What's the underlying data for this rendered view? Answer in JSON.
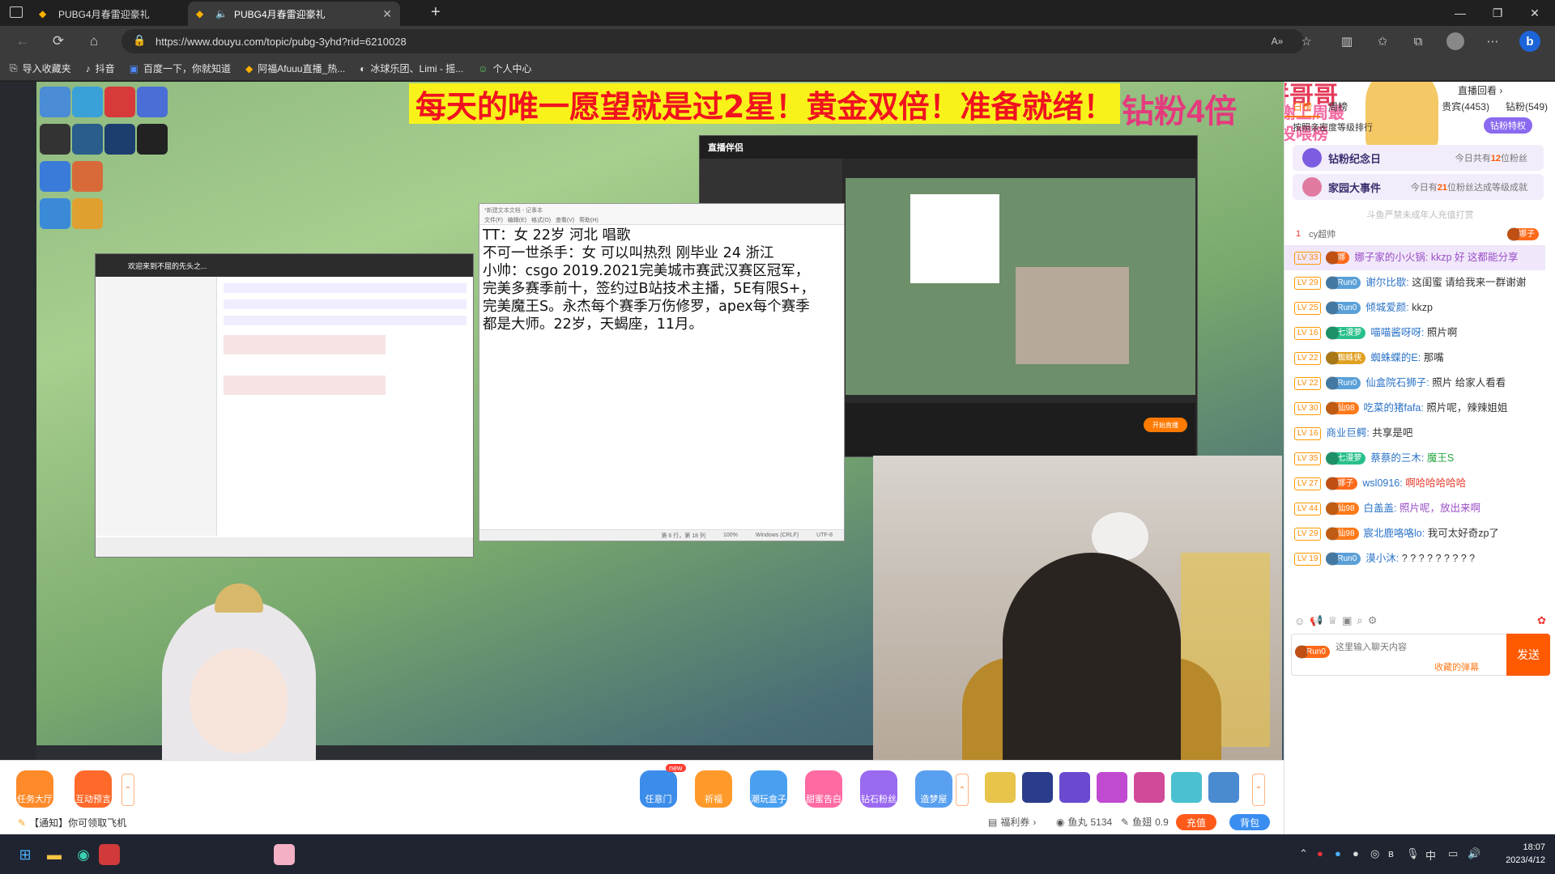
{
  "browser": {
    "tabs": [
      {
        "title": "PUBG4月春雷迎豪礼",
        "active": false
      },
      {
        "title": "PUBG4月春雷迎豪礼",
        "active": true
      }
    ],
    "url": "https://www.douyu.com/topic/pubg-3yhd?rid=6210028",
    "bookmarks": [
      "导入收藏夹",
      "抖音",
      "百度一下，你就知道",
      "阿福Afuuu直播_热...",
      "冰球乐团、Limi - 摇...",
      "个人中心"
    ]
  },
  "stream": {
    "banner": "每天的唯一愿望就是过2星！黄金双倍！准备就绪！",
    "banner_side": "钻粉4倍",
    "overlay_name": "饼哥哥",
    "overlay_thanks": "感谢上周最佳投喂榜",
    "notepad": {
      "title": "*新建文本文档 - 记事本",
      "menu": [
        "文件(F)",
        "编辑(E)",
        "格式(O)",
        "查看(V)",
        "帮助(H)"
      ],
      "text": "TT：女 22岁 河北 唱歌\n不可一世杀手：女 可以叫热烈 刚毕业 24 浙江\n小帅：csgo 2019.2021完美城市赛武汉赛区冠军，\n完美多赛季前十，签约过B站技术主播，5E有限S+，\n完美魔王S。永杰每个赛季万伤修罗，apex每个赛季\n都是大师。22岁，天蝎座，11月。",
      "status": [
        "第 6 行，第 18 列",
        "100%",
        "Windows (CRLF)",
        "UTF-8"
      ]
    },
    "companion_title": "直播伴侣",
    "companion_live": "开始直播",
    "qq_title": "欢迎来到不屈的先头之..."
  },
  "giftbar": {
    "left_buttons": [
      "任务大厅",
      "互动预言"
    ],
    "center_buttons": [
      "任意门",
      "祈福",
      "潮玩盒子",
      "甜蜜告白",
      "钻石粉丝",
      "造梦屋"
    ],
    "new_tag": "new",
    "notice": "【通知】你可领取飞机",
    "wallet": {
      "coupon": "福利券",
      "fish_ball_label": "鱼丸",
      "fish_ball": "5134",
      "fish_wing_label": "鱼翅",
      "fish_wing": "0.9"
    },
    "recharge": "充值",
    "backpack": "背包"
  },
  "rightpanel": {
    "replay": "直播回看",
    "tabs": [
      "日榜",
      "周榜",
      "贵宾(4453)",
      "钻粉(549)"
    ],
    "privilege": "钻粉特权",
    "rank_note": "按照亲密度等级排行",
    "cards": [
      {
        "title": "钻粉纪念日",
        "sub_prefix": "今日共有",
        "sub_num": "12",
        "sub_suffix": "位粉丝"
      },
      {
        "title": "家园大事件",
        "sub_prefix": "今日有",
        "sub_num": "21",
        "sub_suffix": "位粉丝达成等级成就"
      }
    ],
    "minor_note": "斗鱼严禁未成年人充值打赏",
    "top_rank": {
      "num": "1",
      "name": "cy超帅",
      "badge": "娜子"
    },
    "messages": [
      {
        "lv": "LV 33",
        "badge": "娜",
        "user": "娜子家的小火锅:",
        "text": "kkzp 好 这都能分享",
        "hl": true,
        "color": "purple"
      },
      {
        "lv": "LV 29",
        "badge": "Run0",
        "user": "谢尔比歇:",
        "text": "这闺蜜 请给我来一群谢谢"
      },
      {
        "lv": "LV 25",
        "badge": "Run0",
        "user": "倾城爱颜:",
        "text": "kkzp"
      },
      {
        "lv": "LV 16",
        "badge": "七漫萝",
        "user": "喵喵酱呀呀:",
        "text": "照片啊"
      },
      {
        "lv": "LV 22",
        "badge": "蜘蛛侠",
        "user": "蜘蛛蝶的E:",
        "text": "那嘴"
      },
      {
        "lv": "LV 22",
        "badge": "Run0",
        "user": "仙盒院石狮子:",
        "text": "照片 给家人看看"
      },
      {
        "lv": "LV 30",
        "badge": "仙98",
        "user": "吃菜的猪fafa:",
        "text": "照片呢，辣辣姐姐"
      },
      {
        "lv": "LV 16",
        "badge": "",
        "user": "商业巨鳄:",
        "text": "共享是吧"
      },
      {
        "lv": "LV 35",
        "badge": "七漫萝",
        "user": "蔡蔡的三木:",
        "text": "魔王S",
        "color": "green"
      },
      {
        "lv": "LV 27",
        "badge": "娜子",
        "user": "wsl0916:",
        "text": "啊哈哈哈哈哈",
        "color": "red"
      },
      {
        "lv": "LV 44",
        "badge": "仙98",
        "user": "白盖盖:",
        "text": "照片呢，放出来啊",
        "color": "purple"
      },
      {
        "lv": "LV 29",
        "badge": "仙98",
        "user": "宸北鹿咯咯lo:",
        "text": "我可太好奇zp了"
      },
      {
        "lv": "LV 19",
        "badge": "Run0",
        "user": "漠小沐:",
        "text": "? ? ? ? ? ? ? ? ?"
      }
    ],
    "input_placeholder": "这里输入聊天内容",
    "input_badge": "Run0",
    "barrage_label": "收藏的弹幕",
    "send": "发送"
  },
  "taskbar": {
    "time": "18:07",
    "date": "2023/4/12",
    "ime": "中"
  }
}
